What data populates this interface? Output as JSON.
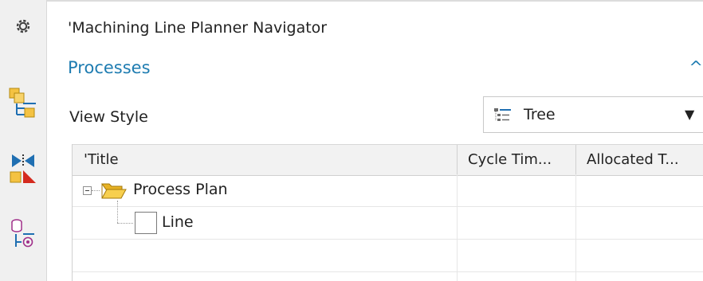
{
  "window": {
    "title": "'Machining Line Planner Navigator"
  },
  "rail": {
    "items": [
      {
        "icon": "settings-gear-icon"
      },
      {
        "icon": "assign-component-icon"
      },
      {
        "icon": "cut-paste-icon"
      },
      {
        "icon": "resource-feature-icon"
      }
    ]
  },
  "section": {
    "title": "Processes",
    "caret": "^"
  },
  "view_style": {
    "label": "View Style",
    "value": "Tree",
    "icon": "tree-view-icon",
    "arrow": "▼"
  },
  "table": {
    "columns": [
      "'Title",
      "Cycle Tim...",
      "Allocated T..."
    ],
    "rows": [
      {
        "title": "Process Plan",
        "icon": "folder-open-icon",
        "cycle_time": "",
        "allocated_time": "",
        "expanded": true
      },
      {
        "title": "Line",
        "icon": "line-box-icon",
        "cycle_time": "",
        "allocated_time": ""
      },
      {
        "title": "",
        "cycle_time": "",
        "allocated_time": ""
      }
    ]
  },
  "colors": {
    "accent": "#1e7cb1",
    "folder": "#f4c242",
    "rail_bg": "#f0f0f0",
    "header_bg": "#f2f2f2"
  }
}
